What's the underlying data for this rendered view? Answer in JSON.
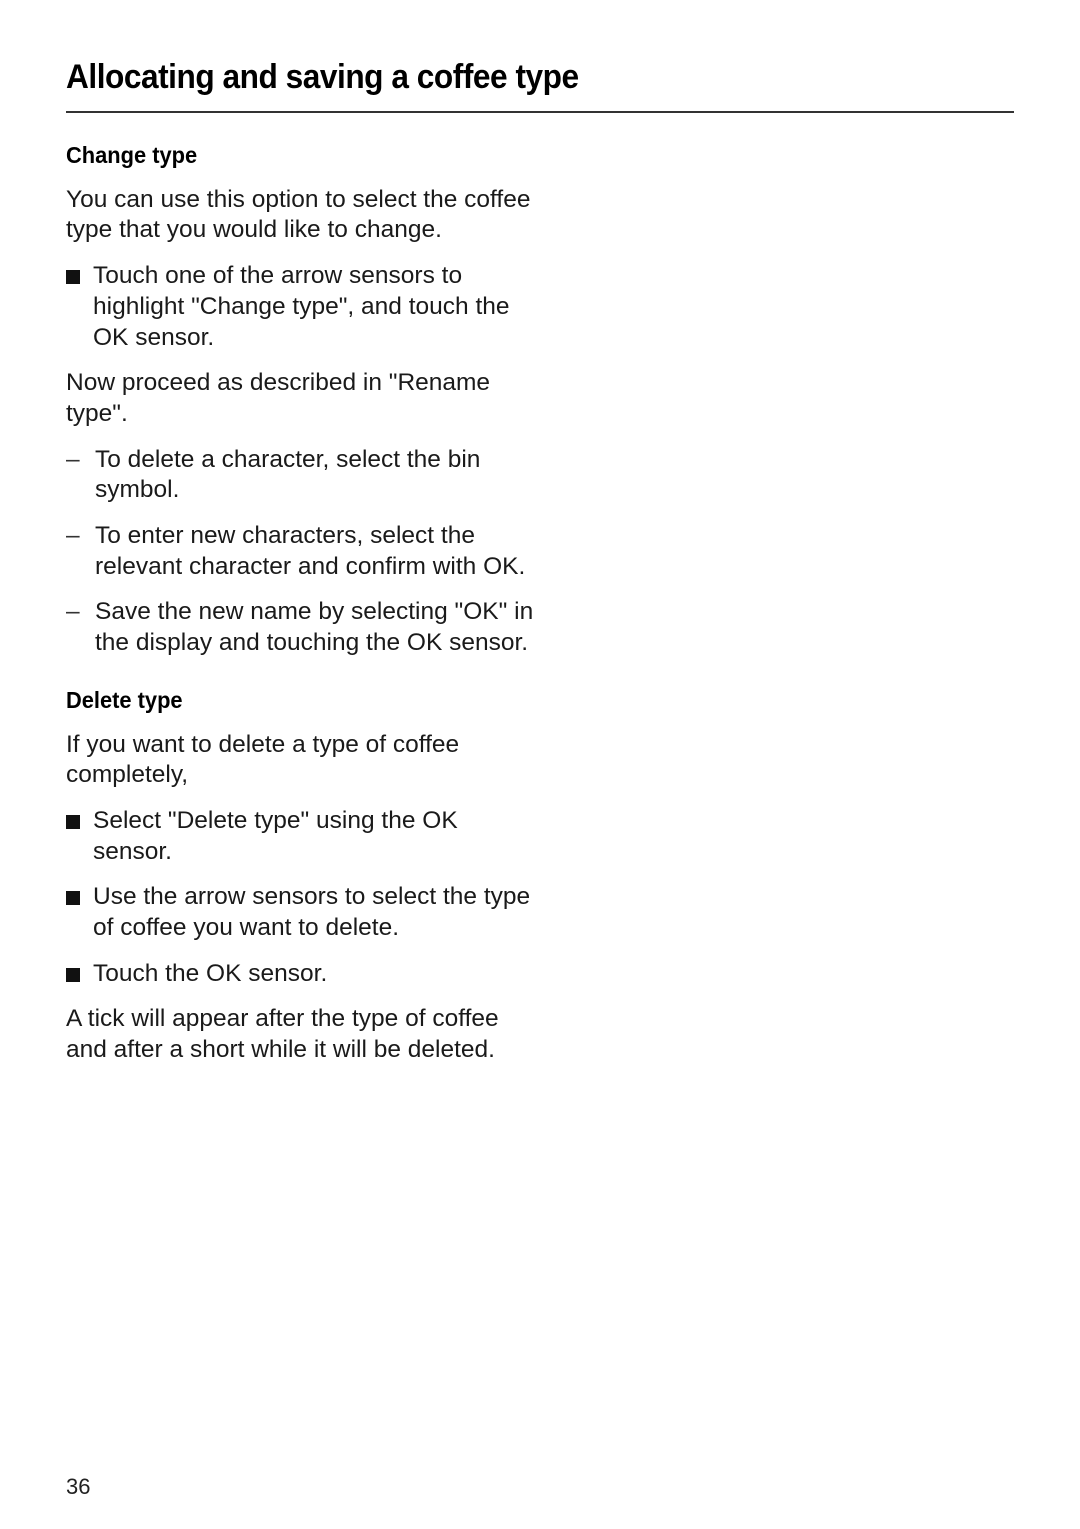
{
  "header": {
    "title": "Allocating and saving a coffee type"
  },
  "sections": [
    {
      "heading": "Change type",
      "intro": "You can use this option to select the coffee type that you would like to change.",
      "steps": [
        "Touch one of the arrow sensors to highlight \"Change type\", and touch the OK sensor."
      ],
      "after": "Now proceed as described in \"Rename type\".",
      "substeps": [
        "To delete a character, select the bin symbol.",
        "To enter new characters, select the relevant character and confirm with OK.",
        "Save the new name by selecting \"OK\" in the display and touching the OK sensor."
      ]
    },
    {
      "heading": "Delete type",
      "intro": "If you want to delete a type of coffee completely,",
      "steps": [
        "Select \"Delete type\" using the OK sensor.",
        "Use the arrow sensors to select the type of coffee you want to delete.",
        "Touch the OK sensor."
      ],
      "after": "A tick will appear after the type of coffee and after a short while it will be deleted."
    }
  ],
  "bullet_icon": "square-bullet",
  "dash_icon": "en-dash",
  "dash_char": "–",
  "page_number": "36"
}
